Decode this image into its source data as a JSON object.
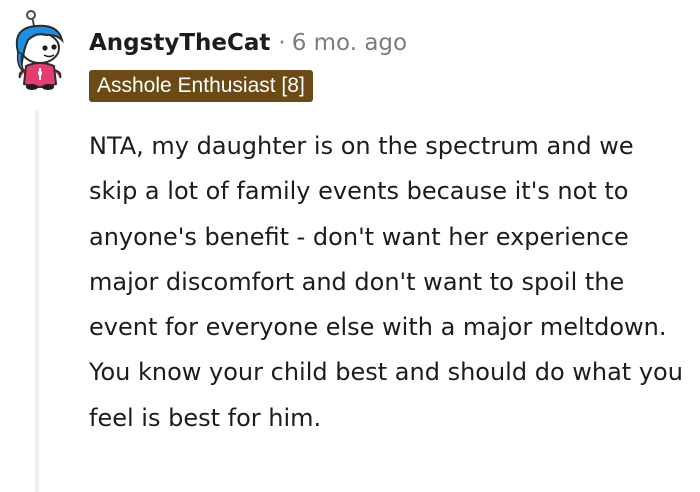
{
  "comment": {
    "username": "AngstyTheCat",
    "separator": "·",
    "timestamp": "6 mo. ago",
    "flair": "Asshole Enthusiast [8]",
    "body": "NTA, my daughter is on the spectrum and we skip a lot of family events because it's not to anyone's benefit - don't want her experience major discomfort and don't want to spoil the event for everyone else with a major meltdown. You know your child best and should do what you feel is best for him.",
    "avatar_icon": "snoo-avatar-icon",
    "colors": {
      "flair_bg": "#6b4a16",
      "flair_text": "#ffffff",
      "meta_gray": "#7c7c7c",
      "text": "#1c1c1c",
      "thread_line": "#edeff1"
    }
  }
}
